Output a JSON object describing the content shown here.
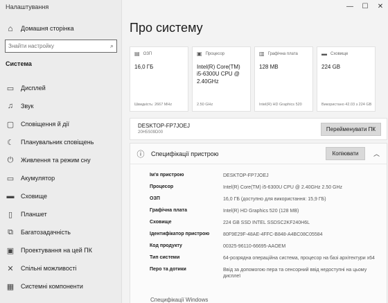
{
  "window": {
    "title": "Налаштування",
    "controls": [
      "—",
      "☐",
      "✕"
    ]
  },
  "sidebar": {
    "home_label": "Домашня сторінка",
    "search_placeholder": "Знайти настройку",
    "section_title": "Система",
    "items": [
      {
        "label": "Дисплей",
        "icon": "display-icon"
      },
      {
        "label": "Звук",
        "icon": "speaker-icon"
      },
      {
        "label": "Сповіщення й дії",
        "icon": "notification-icon"
      },
      {
        "label": "Планувальник сповіщень",
        "icon": "moon-icon"
      },
      {
        "label": "Живлення та режим сну",
        "icon": "power-icon"
      },
      {
        "label": "Акумулятор",
        "icon": "battery-icon"
      },
      {
        "label": "Сховище",
        "icon": "storage-icon"
      },
      {
        "label": "Планшет",
        "icon": "tablet-icon"
      },
      {
        "label": "Багатозадачність",
        "icon": "multitask-icon"
      },
      {
        "label": "Проектування на цей ПК",
        "icon": "project-icon"
      },
      {
        "label": "Спільні можливості",
        "icon": "shared-icon"
      },
      {
        "label": "Системні компоненти",
        "icon": "components-icon"
      }
    ]
  },
  "main": {
    "title": "Про систему",
    "cards": [
      {
        "label": "ОЗП",
        "value": "16,0 ГБ",
        "sub": "Швидкість: 2667 MHz",
        "icon": "ram-icon"
      },
      {
        "label": "Процесор",
        "value": "Intel(R) Core(TM) i5-6300U CPU @ 2.40GHz",
        "sub": "2.50 GHz",
        "icon": "cpu-icon"
      },
      {
        "label": "Графічна плата",
        "value": "128 MB",
        "sub": "Intel(R) HD Graphics 520",
        "icon": "gpu-icon"
      },
      {
        "label": "Сховище",
        "value": "224 GB",
        "sub": "Використано 42.03 з 224 GB",
        "icon": "disk-icon"
      }
    ],
    "device": {
      "name": "DESKTOP-FP7JOEJ",
      "model": "20H5S09D00",
      "rename_label": "Перейменувати ПК"
    },
    "specs": {
      "title": "Специфікації пристрою",
      "copy_label": "Копіювати",
      "rows": [
        {
          "key": "Ім'я пристрою",
          "value": "DESKTOP-FP7JOEJ"
        },
        {
          "key": "Процесор",
          "value": "Intel(R) Core(TM) i5-6300U CPU @ 2.40GHz   2.50 GHz"
        },
        {
          "key": "ОЗП",
          "value": "16,0 ГБ (доступно для використання: 15,9 ГБ)"
        },
        {
          "key": "Графічна плата",
          "value": "Intel(R) HD Graphics 520 (128 MB)"
        },
        {
          "key": "Сховище",
          "value": "224 GB SSD INTEL SSDSC2KF240H6L"
        },
        {
          "key": "Ідентифікатор пристрою",
          "value": "80F9E29F-48AE-4FFC-B848-A4BC08C05584"
        },
        {
          "key": "Код продукту",
          "value": "00325-96110-66695-AAOEM"
        },
        {
          "key": "Тип системи",
          "value": "64-розрядна операційна система, процесор на базі архітектури x64"
        },
        {
          "key": "Перо та дотики",
          "value": "Ввід за допомогою пера та сенсорний ввід недоступні на цьому дисплеї"
        }
      ]
    },
    "footer_text": "Специфікації Windows"
  }
}
